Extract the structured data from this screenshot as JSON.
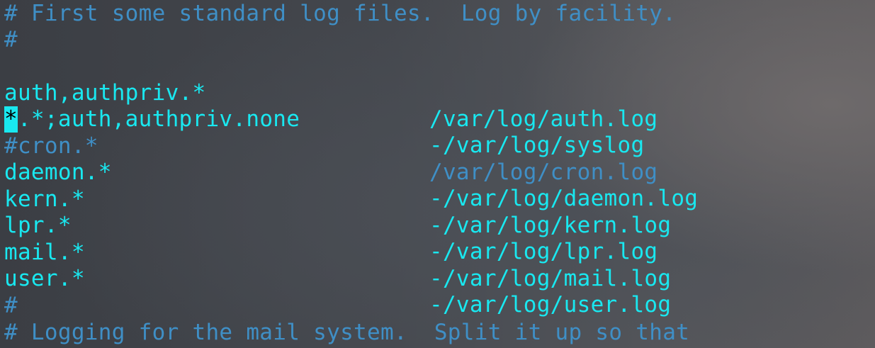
{
  "terminal": {
    "lines": [
      {
        "type": "comment",
        "text": "# First some standard log files.  Log by facility."
      },
      {
        "type": "comment",
        "text": "#"
      },
      {
        "type": "rule",
        "selector": "auth,authpriv.*",
        "action": "/var/log/auth.log"
      },
      {
        "type": "rule_cursor",
        "cursor_char": "*",
        "selector_rest": ".*;auth,authpriv.none",
        "action": "-/var/log/syslog"
      },
      {
        "type": "commented_rule",
        "selector": "#cron.*",
        "action": "/var/log/cron.log"
      },
      {
        "type": "rule",
        "selector": "daemon.*",
        "action": "-/var/log/daemon.log"
      },
      {
        "type": "rule",
        "selector": "kern.*",
        "action": "-/var/log/kern.log"
      },
      {
        "type": "rule",
        "selector": "lpr.*",
        "action": "-/var/log/lpr.log"
      },
      {
        "type": "rule",
        "selector": "mail.*",
        "action": "-/var/log/mail.log"
      },
      {
        "type": "rule",
        "selector": "user.*",
        "action": "-/var/log/user.log"
      },
      {
        "type": "blank",
        "text": ""
      },
      {
        "type": "comment",
        "text": "#"
      },
      {
        "type": "comment",
        "text": "# Logging for the mail system.  Split it up so that"
      }
    ]
  },
  "colors": {
    "comment": "#3f8fc6",
    "active": "#19e8f0",
    "cursor_bg": "#19e8f0"
  }
}
